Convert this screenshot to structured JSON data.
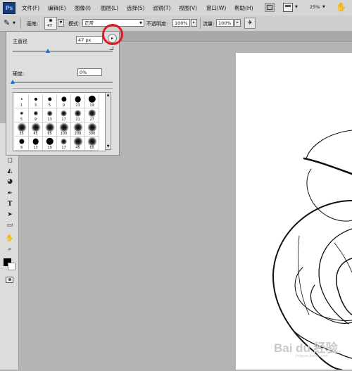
{
  "app": {
    "logo": "Ps"
  },
  "menu": [
    "文件(F)",
    "编辑(E)",
    "图像(I)",
    "图层(L)",
    "选择(S)",
    "滤镜(T)",
    "视图(V)",
    "窗口(W)",
    "帮助(H)"
  ],
  "menubar_right": {
    "zoom": "25%"
  },
  "options_bar": {
    "brush_label": "画笔:",
    "brush_size": "47",
    "mode_label": "模式:",
    "mode_value": "正常",
    "opacity_label": "不透明度:",
    "opacity_value": "100%",
    "flow_label": "流量:",
    "flow_value": "100%"
  },
  "brush_panel": {
    "diameter_label": "主直径",
    "diameter_value": "47 px",
    "diameter_fraction": 0.1,
    "hardness_label": "硬度:",
    "hardness_value": "0%",
    "hardness_fraction": 0.0,
    "presets": [
      {
        "size": "1",
        "hard": true
      },
      {
        "size": "3",
        "hard": true
      },
      {
        "size": "5",
        "hard": true
      },
      {
        "size": "9",
        "hard": true
      },
      {
        "size": "13",
        "hard": true
      },
      {
        "size": "19",
        "hard": true
      },
      {
        "size": "5",
        "hard": false
      },
      {
        "size": "9",
        "hard": false
      },
      {
        "size": "13",
        "hard": false
      },
      {
        "size": "17",
        "hard": false
      },
      {
        "size": "21",
        "hard": false
      },
      {
        "size": "27",
        "hard": false
      },
      {
        "size": "35",
        "hard": false
      },
      {
        "size": "45",
        "hard": false
      },
      {
        "size": "65",
        "hard": false
      },
      {
        "size": "100",
        "hard": false
      },
      {
        "size": "200",
        "hard": false
      },
      {
        "size": "300",
        "hard": false
      },
      {
        "size": "9",
        "hard": true
      },
      {
        "size": "13",
        "hard": true
      },
      {
        "size": "19",
        "hard": true
      },
      {
        "size": "17",
        "hard": false
      },
      {
        "size": "45",
        "hard": false
      },
      {
        "size": "65",
        "hard": false
      }
    ]
  },
  "watermark": {
    "main": "Bai du 经验",
    "sub": "jingyan.baidu.com"
  },
  "colors": {
    "highlight": "#e01b24",
    "slider": "#1e6bd6",
    "menubar": "#d6d6d6",
    "workspace": "#b4b4b4"
  }
}
